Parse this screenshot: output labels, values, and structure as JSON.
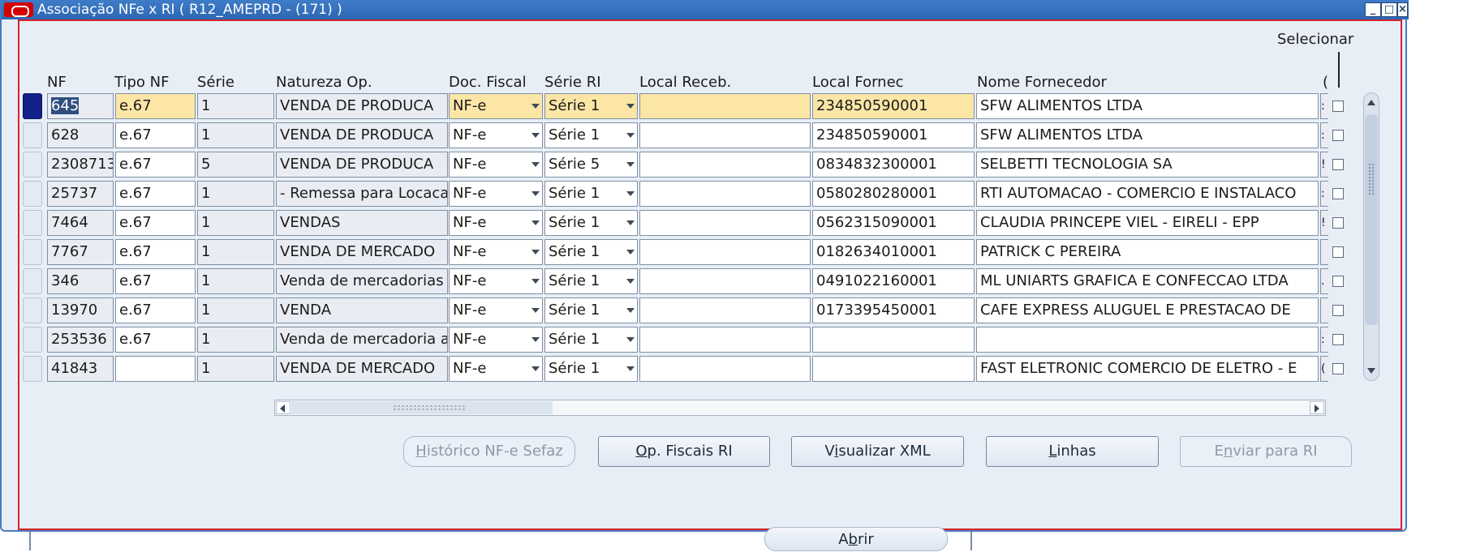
{
  "window": {
    "title": "Associação NFe x RI ( R12_AMEPRD - (171) )",
    "controls": [
      "minimize",
      "maximize",
      "close"
    ]
  },
  "selecionar_label": "Selecionar",
  "columns": {
    "nf": "NF",
    "tipo_nf": "Tipo NF",
    "serie": "Série",
    "natureza_op": "Natureza Op.",
    "doc_fiscal": "Doc. Fiscal",
    "serie_ri": "Série RI",
    "local_receb": "Local Receb.",
    "local_fornec": "Local Fornec",
    "nome_fornecedor": "Nome Fornecedor",
    "trailing": "("
  },
  "rows": [
    {
      "nf": "645",
      "tipo_nf": "e.67",
      "serie": "1",
      "natureza_op": "VENDA DE PRODUCA",
      "doc_fiscal": "NF-e",
      "serie_ri": "Série 1",
      "local_receb": "",
      "local_fornec": "234850590001",
      "nome_fornecedor": "SFW ALIMENTOS LTDA",
      "stub": ":"
    },
    {
      "nf": "628",
      "tipo_nf": "e.67",
      "serie": "1",
      "natureza_op": "VENDA DE PRODUCA",
      "doc_fiscal": "NF-e",
      "serie_ri": "Série 1",
      "local_receb": "",
      "local_fornec": "234850590001",
      "nome_fornecedor": "SFW ALIMENTOS LTDA",
      "stub": ":"
    },
    {
      "nf": "2308713",
      "tipo_nf": "e.67",
      "serie": "5",
      "natureza_op": "VENDA DE PRODUCA",
      "doc_fiscal": "NF-e",
      "serie_ri": "Série 5",
      "local_receb": "",
      "local_fornec": "0834832300001",
      "nome_fornecedor": "SELBETTI TECNOLOGIA SA",
      "stub": "!"
    },
    {
      "nf": "25737",
      "tipo_nf": "e.67",
      "serie": "1",
      "natureza_op": "- Remessa para Locaca",
      "doc_fiscal": "NF-e",
      "serie_ri": "Série 1",
      "local_receb": "",
      "local_fornec": "0580280280001",
      "nome_fornecedor": "RTI AUTOMACAO - COMERCIO E INSTALACO",
      "stub": ":"
    },
    {
      "nf": "7464",
      "tipo_nf": "e.67",
      "serie": "1",
      "natureza_op": "VENDAS",
      "doc_fiscal": "NF-e",
      "serie_ri": "Série 1",
      "local_receb": "",
      "local_fornec": "0562315090001",
      "nome_fornecedor": "CLAUDIA PRINCEPE VIEL - EIRELI - EPP",
      "stub": "!"
    },
    {
      "nf": "7767",
      "tipo_nf": "e.67",
      "serie": "1",
      "natureza_op": "VENDA DE MERCADO",
      "doc_fiscal": "NF-e",
      "serie_ri": "Série 1",
      "local_receb": "",
      "local_fornec": "0182634010001",
      "nome_fornecedor": "PATRICK C PEREIRA",
      "stub": ""
    },
    {
      "nf": "346",
      "tipo_nf": "e.67",
      "serie": "1",
      "natureza_op": "Venda de mercadorias",
      "doc_fiscal": "NF-e",
      "serie_ri": "Série 1",
      "local_receb": "",
      "local_fornec": "0491022160001",
      "nome_fornecedor": "ML UNIARTS GRAFICA E CONFECCAO LTDA",
      "stub": "."
    },
    {
      "nf": "13970",
      "tipo_nf": "e.67",
      "serie": "1",
      "natureza_op": "VENDA",
      "doc_fiscal": "NF-e",
      "serie_ri": "Série 1",
      "local_receb": "",
      "local_fornec": "0173395450001",
      "nome_fornecedor": "CAFE EXPRESS ALUGUEL E PRESTACAO DE",
      "stub": ""
    },
    {
      "nf": "253536",
      "tipo_nf": "e.67",
      "serie": "1",
      "natureza_op": "Venda de mercadoria ac",
      "doc_fiscal": "NF-e",
      "serie_ri": "Série 1",
      "local_receb": "",
      "local_fornec": "",
      "nome_fornecedor": "",
      "stub": ":"
    },
    {
      "nf": "41843",
      "tipo_nf": "",
      "serie": "1",
      "natureza_op": "VENDA DE MERCADO",
      "doc_fiscal": "NF-e",
      "serie_ri": "Série 1",
      "local_receb": "",
      "local_fornec": "",
      "nome_fornecedor": "FAST ELETRONIC COMERCIO DE ELETRO - E",
      "stub": "("
    }
  ],
  "buttons": {
    "historico": {
      "pre": "",
      "key": "H",
      "post": "istórico NF-e Sefaz",
      "enabled": false
    },
    "op_fiscais": {
      "pre": "",
      "key": "O",
      "post": "p. Fiscais RI",
      "enabled": true
    },
    "visualizar": {
      "pre": "V",
      "key": "i",
      "post": "sualizar XML",
      "enabled": true
    },
    "linhas": {
      "pre": "",
      "key": "L",
      "post": "inhas",
      "enabled": true
    },
    "enviar": {
      "pre": "E",
      "key": "n",
      "post": "viar para RI",
      "enabled": false
    }
  },
  "abrir_button": {
    "pre": "A",
    "key": "b",
    "post": "rir"
  },
  "colors": {
    "title_bar": "#2d67b3",
    "focus_frame": "#d4242e",
    "current_record_marker": "#12208a",
    "required_field": "#fbe6a6"
  }
}
